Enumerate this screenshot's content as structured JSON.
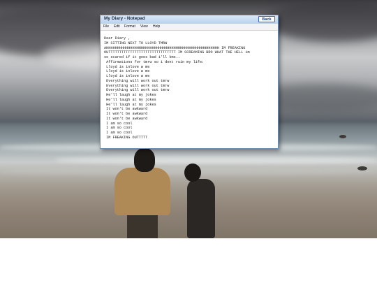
{
  "window": {
    "title": "My Diary - Notepad",
    "back_label": "Back",
    "menu": [
      "File",
      "Edit",
      "Format",
      "View",
      "Help"
    ]
  },
  "diary": {
    "lines": [
      "Dear Diary ,",
      "IM SITTING NEXT TO LLOYD TMRW",
      "AHHHHHHHHHHHHHHHHHHHHHHHHHHHHHHHHHHHHHHHHHHHHHHHHHHHH IM FREAKING",
      "OUTTTTTTTTTTTTTTTTTTTTTTTTTTTTTTT IM SCREAMING BRO WHAT THE HELL im",
      "so scared if it goes bad i'll kms..",
      " Affirmations for tmrw so i dont ruin my life:",
      " Lloyd is inlove w me",
      " Lloyd is inlove w me",
      " Lloyd is inlove w me",
      " Everything will work out tmrw",
      " Everything will work out tmrw",
      " Everything will work out tmrw",
      " He'll laugh at my jokes",
      " He'll laugh at my jokes",
      " He'll laugh at my jokes",
      " It won't be awkward",
      " It won't be awkward",
      " It won't be awkward",
      " I am so cool",
      " I am so cool",
      " I am so cool",
      " IM FREAKING OUTTTTT"
    ]
  }
}
